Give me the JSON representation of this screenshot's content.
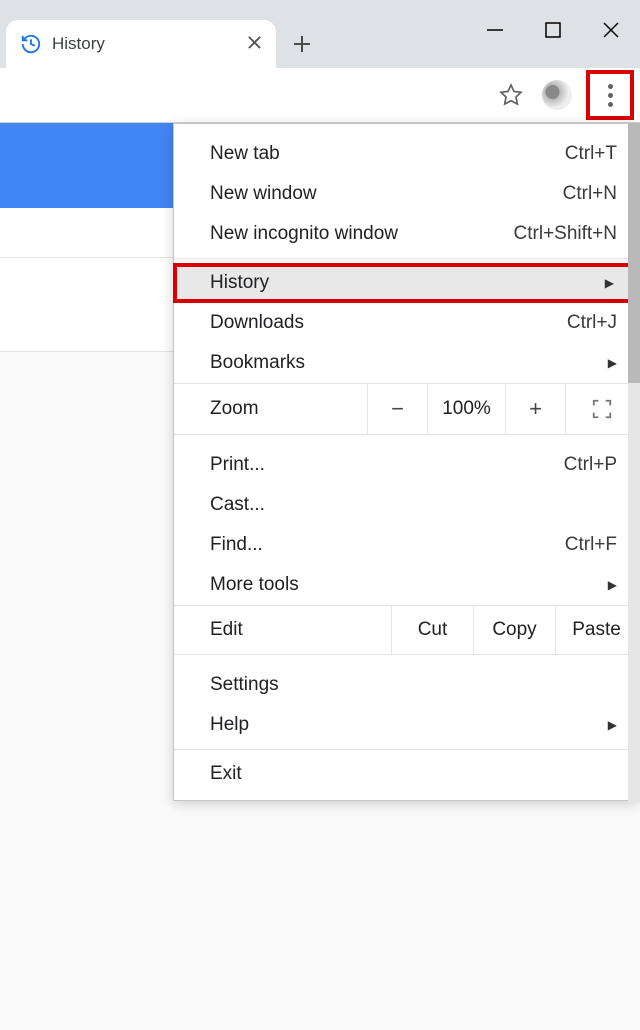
{
  "tab": {
    "title": "History"
  },
  "menu": {
    "new_tab": {
      "label": "New tab",
      "shortcut": "Ctrl+T"
    },
    "new_window": {
      "label": "New window",
      "shortcut": "Ctrl+N"
    },
    "new_incognito": {
      "label": "New incognito window",
      "shortcut": "Ctrl+Shift+N"
    },
    "history": {
      "label": "History"
    },
    "downloads": {
      "label": "Downloads",
      "shortcut": "Ctrl+J"
    },
    "bookmarks": {
      "label": "Bookmarks"
    },
    "zoom": {
      "label": "Zoom",
      "value": "100%"
    },
    "print": {
      "label": "Print...",
      "shortcut": "Ctrl+P"
    },
    "cast": {
      "label": "Cast..."
    },
    "find": {
      "label": "Find...",
      "shortcut": "Ctrl+F"
    },
    "more_tools": {
      "label": "More tools"
    },
    "edit": {
      "label": "Edit",
      "cut": "Cut",
      "copy": "Copy",
      "paste": "Paste"
    },
    "settings": {
      "label": "Settings"
    },
    "help": {
      "label": "Help"
    },
    "exit": {
      "label": "Exit"
    }
  }
}
